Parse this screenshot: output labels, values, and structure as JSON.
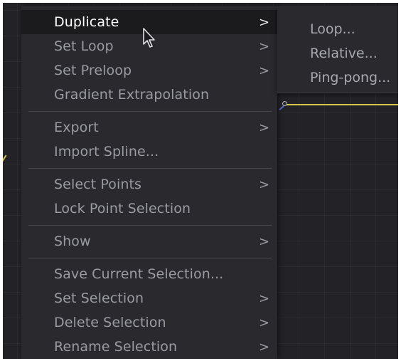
{
  "menu": {
    "items": [
      {
        "label": "Duplicate",
        "arrow": ">"
      },
      {
        "label": "Set Loop",
        "arrow": ">"
      },
      {
        "label": "Set Preloop",
        "arrow": ">"
      },
      {
        "label": "Gradient Extrapolation",
        "arrow": ""
      },
      {
        "label": "Export",
        "arrow": ">"
      },
      {
        "label": "Import Spline...",
        "arrow": ""
      },
      {
        "label": "Select Points",
        "arrow": ">"
      },
      {
        "label": "Lock Point Selection",
        "arrow": ""
      },
      {
        "label": "Show",
        "arrow": ">"
      },
      {
        "label": "Save Current Selection...",
        "arrow": ""
      },
      {
        "label": "Set Selection",
        "arrow": ">"
      },
      {
        "label": "Delete Selection",
        "arrow": ">"
      },
      {
        "label": "Rename Selection",
        "arrow": ">"
      }
    ]
  },
  "submenu": {
    "items": [
      {
        "label": "Loop..."
      },
      {
        "label": "Relative..."
      },
      {
        "label": "Ping-pong..."
      }
    ]
  },
  "colors": {
    "background": "#232327",
    "menu": "#2a2a2e",
    "highlight": "#1b1b1e",
    "curve": "#d6c64a",
    "text": "#9a9aa2"
  },
  "icons": {
    "cursor": "arrow-pointer-icon",
    "submenu": "chevron-right-icon"
  }
}
